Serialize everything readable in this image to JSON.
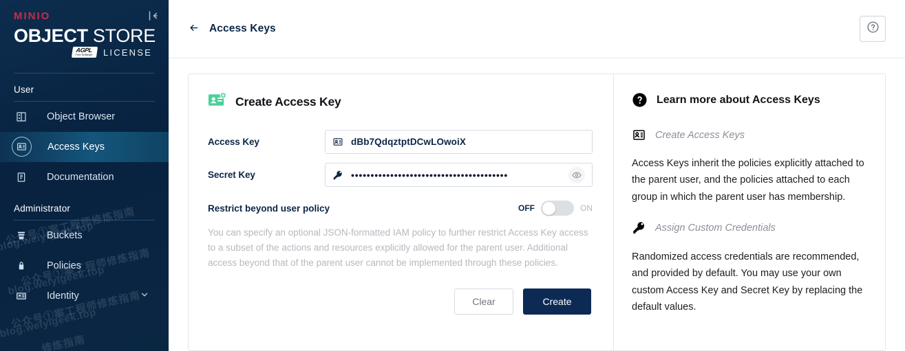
{
  "sidebar": {
    "brand": {
      "minio": "MINIO",
      "object": "OBJECT",
      "store": "STORE",
      "agpl": "AGPL",
      "agpl_sub": "Free Software",
      "license": "LICENSE"
    },
    "collapse_icon": "collapse-sidebar-icon",
    "sections": [
      {
        "title": "User",
        "items": [
          {
            "label": "Object Browser",
            "icon": "object-browser-icon",
            "active": false
          },
          {
            "label": "Access Keys",
            "icon": "access-keys-icon",
            "active": true
          },
          {
            "label": "Documentation",
            "icon": "documentation-icon",
            "active": false
          }
        ]
      },
      {
        "title": "Administrator",
        "items": [
          {
            "label": "Buckets",
            "icon": "bucket-icon",
            "active": false
          },
          {
            "label": "Policies",
            "icon": "policy-lock-icon",
            "active": false
          },
          {
            "label": "Identity",
            "icon": "identity-icon",
            "active": false,
            "expandable": true
          }
        ]
      }
    ],
    "watermarks": [
      "公众号①案工程师修炼指南",
      "blog.weiyigeek.top",
      "公众号①案工程师修炼指南",
      "blog.weiyigeek.top",
      "公众号①案工程师修炼指南",
      "blog.weiyigeek.top",
      "修炼指南",
      "blog.weiyigeek.top"
    ]
  },
  "topbar": {
    "back_icon": "back-arrow-icon",
    "title": "Access Keys",
    "help_icon": "help-circle-icon"
  },
  "form": {
    "header_icon": "create-access-key-icon",
    "header_title": "Create Access Key",
    "access_key": {
      "label": "Access Key",
      "icon": "id-card-icon",
      "value": "dBb7QdqztptDCwLOwoiX"
    },
    "secret_key": {
      "label": "Secret Key",
      "icon": "key-icon",
      "value": "••••••••••••••••••••••••••••••••••••••••",
      "reveal_icon": "eye-icon"
    },
    "restrict": {
      "label": "Restrict beyond user policy",
      "off_label": "OFF",
      "on_label": "ON",
      "state": "off"
    },
    "help_text": "You can specify an optional JSON-formatted IAM policy to further restrict Access Key access to a subset of the actions and resources explicitly allowed for the parent user. Additional access beyond that of the parent user cannot be implemented through these policies.",
    "buttons": {
      "clear": "Clear",
      "create": "Create"
    }
  },
  "info": {
    "header_icon": "help-circle-filled-icon",
    "header_title": "Learn more about Access Keys",
    "sub1_icon": "id-card-icon",
    "sub1": "Create Access Keys",
    "para1": "Access Keys inherit the policies explicitly attached to the parent user, and the policies attached to each group in which the parent user has membership.",
    "sub2_icon": "key-icon",
    "sub2": "Assign Custom Credentials",
    "para2": "Randomized access credentials are recommended, and provided by default. You may use your own custom Access Key and Secret Key by replacing the default values."
  },
  "colors": {
    "sidebar_bg": "#082240",
    "sidebar_active": "#14567c",
    "brand_red": "#c72c48",
    "create_btn": "#0d2a55",
    "accent_green": "#4ccf9b",
    "navy_text": "#0b2647"
  }
}
